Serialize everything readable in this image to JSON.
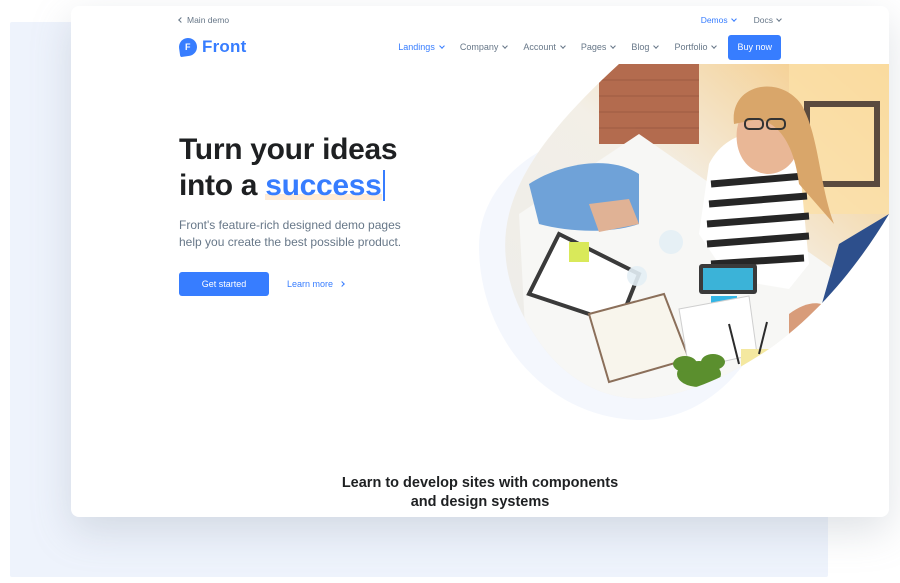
{
  "topbar": {
    "back_label": "Main demo",
    "links": [
      {
        "label": "Demos",
        "active": true
      },
      {
        "label": "Docs",
        "active": false
      }
    ]
  },
  "navbar": {
    "logo_letter": "F",
    "logo_text": "Front",
    "menu": [
      {
        "label": "Landings",
        "active": true
      },
      {
        "label": "Company",
        "active": false
      },
      {
        "label": "Account",
        "active": false
      },
      {
        "label": "Pages",
        "active": false
      },
      {
        "label": "Blog",
        "active": false
      },
      {
        "label": "Portfolio",
        "active": false
      }
    ],
    "cta": "Buy now"
  },
  "hero": {
    "line1": "Turn your ideas",
    "line2_prefix": "into a ",
    "typed_word": "success",
    "subtitle": "Front's feature-rich designed demo pages help you create the best possible product.",
    "primary_cta": "Get started",
    "secondary_cta": "Learn more"
  },
  "section": {
    "title_line1": "Learn to develop sites with components",
    "title_line2": "and design systems"
  },
  "colors": {
    "primary": "#377dff",
    "heading": "#1e2022",
    "body": "#677788",
    "backdrop": "#eef3fc"
  },
  "icons": {
    "back": "chevron-left-icon",
    "dropdown": "chevron-down-icon",
    "learn_more": "chevron-right-icon"
  }
}
